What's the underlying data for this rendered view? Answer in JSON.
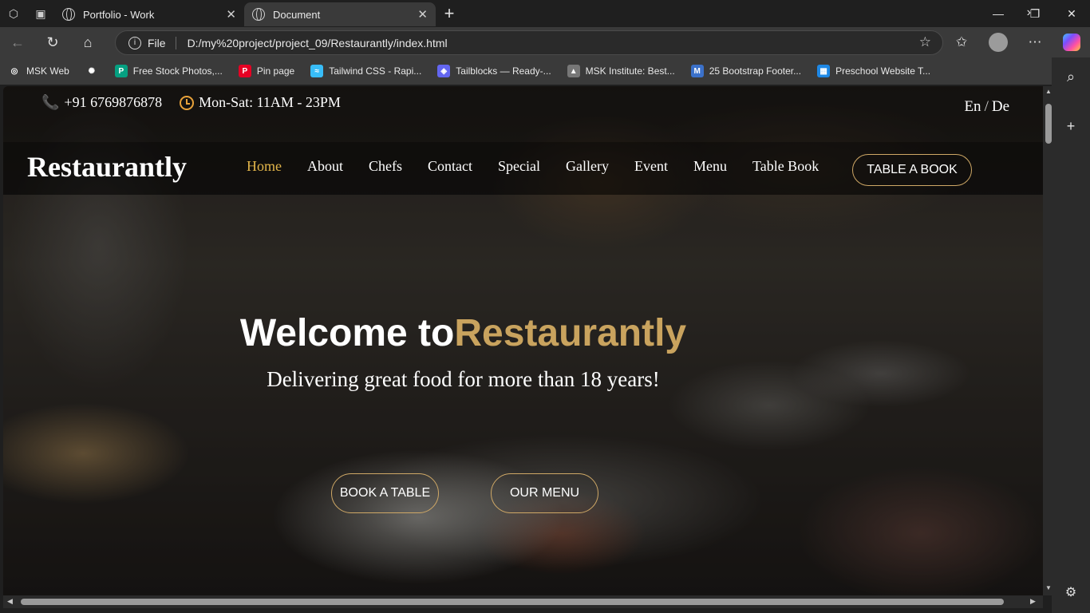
{
  "browser": {
    "tabs": [
      {
        "title": "Portfolio - Work",
        "active": false
      },
      {
        "title": "Document",
        "active": true
      }
    ],
    "address": {
      "scheme": "File",
      "url": "D:/my%20project/project_09/Restaurantly/index.html"
    },
    "bookmarks": [
      {
        "label": "MSK Web",
        "icon": "globe-icon",
        "color": "#3a3a3a"
      },
      {
        "label": "",
        "icon": "openai-icon",
        "color": "#3a3a3a"
      },
      {
        "label": "Free Stock Photos,...",
        "icon": "pexels-icon",
        "color": "#05a081"
      },
      {
        "label": "Pin page",
        "icon": "pinterest-icon",
        "color": "#e60023"
      },
      {
        "label": "Tailwind CSS - Rapi...",
        "icon": "tailwind-icon",
        "color": "#38bdf8"
      },
      {
        "label": "Tailblocks — Ready-...",
        "icon": "tailblocks-icon",
        "color": "#6366f1"
      },
      {
        "label": "MSK Institute: Best...",
        "icon": "msk-icon",
        "color": "#777777"
      },
      {
        "label": "25 Bootstrap Footer...",
        "icon": "mdb-icon",
        "color": "#3b71ca"
      },
      {
        "label": "Preschool Website T...",
        "icon": "preschool-icon",
        "color": "#1e88e5"
      }
    ]
  },
  "site": {
    "phone": "+91 6769876878",
    "hours": "Mon-Sat: 11AM - 23PM",
    "lang_en": "En",
    "lang_sep": "/",
    "lang_de": "De",
    "brand": "Restaurantly",
    "nav": [
      "Home",
      "About",
      "Chefs",
      "Contact",
      "Special",
      "Gallery",
      "Event",
      "Menu",
      "Table Book"
    ],
    "nav_active": "Home",
    "nav_button": "TABLE A BOOK",
    "hero": {
      "welcome": "Welcome to",
      "brand": "Restaurantly",
      "tagline": "Delivering great food for more than 18 years!",
      "cta_book": "BOOK A TABLE",
      "cta_menu": "OUR MENU"
    },
    "colors": {
      "accent": "#e2b54a",
      "gold": "#c9a35e",
      "icon": "#f0a830"
    }
  }
}
